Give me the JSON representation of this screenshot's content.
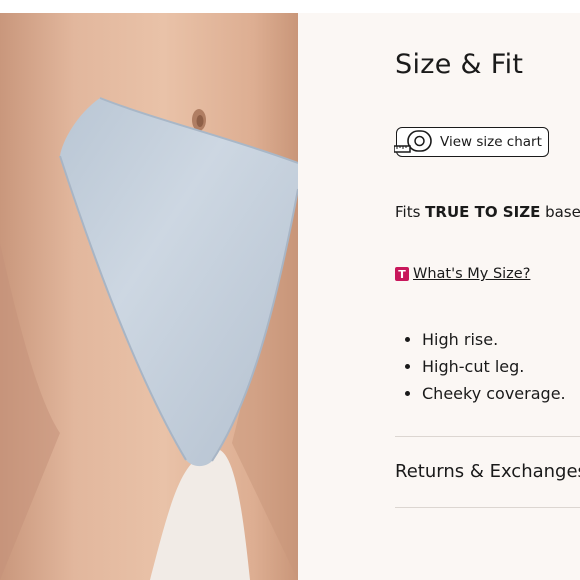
{
  "size_fit": {
    "title": "Size & Fit",
    "size_chart_button": "View size chart",
    "fit_prefix": "Fits ",
    "fit_strong": "TRUE TO SIZE",
    "fit_suffix": " based",
    "whats_my_size": {
      "badge": "T",
      "link": "What's My Size?"
    },
    "features": [
      "High rise.",
      "High-cut leg.",
      "Cheeky coverage."
    ],
    "returns_label": "Returns & Exchanges"
  },
  "colors": {
    "panel_background": "#fbf7f4",
    "badge": "#c8175b",
    "garment": "#c5d0dc"
  },
  "icons": {
    "size_chart": "tape-measure-icon"
  }
}
